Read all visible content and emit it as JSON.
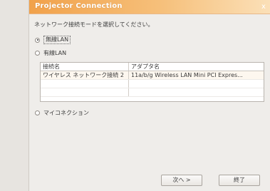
{
  "window": {
    "title": "Projector Connection",
    "close_glyph": "x"
  },
  "instruction": "ネットワーク接続モードを選択してください。",
  "mode_options": [
    {
      "label": "無線LAN",
      "selected": true
    },
    {
      "label": "有線LAN",
      "selected": false
    }
  ],
  "connection_table": {
    "headers": {
      "name": "接続名",
      "adapter": "アダプタ名"
    },
    "rows": [
      {
        "name": "ワイヤレス ネットワーク接続 2",
        "adapter": "11a/b/g Wireless LAN Mini PCI Expres..."
      },
      {
        "name": "",
        "adapter": ""
      },
      {
        "name": "",
        "adapter": ""
      }
    ]
  },
  "my_connection_label": "マイコネクション",
  "buttons": {
    "next_label": "次へ >",
    "finish_label": "終了"
  },
  "colors": {
    "title_gradient_start": "#f1a14a",
    "title_gradient_end": "#fbe0b8",
    "dialog_background": "#efedea"
  }
}
